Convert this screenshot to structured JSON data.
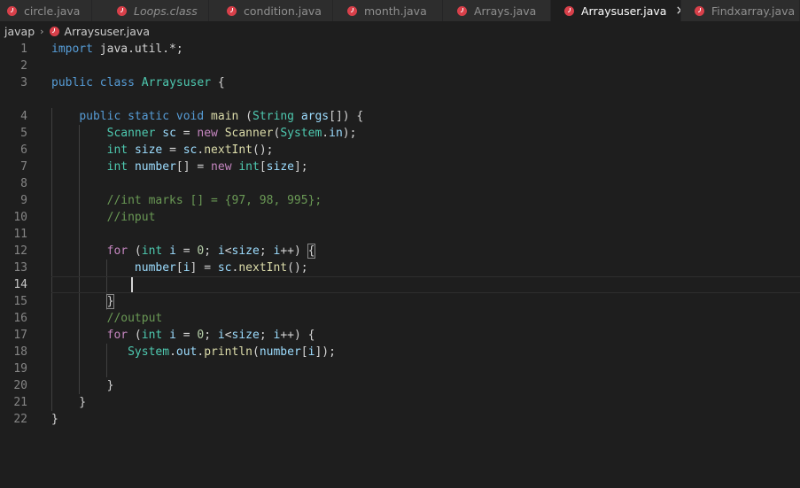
{
  "tabs": [
    {
      "label": "circle.java",
      "italic": false,
      "active": false
    },
    {
      "label": "Loops.class",
      "italic": true,
      "active": false
    },
    {
      "label": "condition.java",
      "italic": false,
      "active": false
    },
    {
      "label": "month.java",
      "italic": false,
      "active": false
    },
    {
      "label": "Arrays.java",
      "italic": false,
      "active": false
    },
    {
      "label": "Arraysuser.java",
      "italic": false,
      "active": true
    },
    {
      "label": "Findxarray.java",
      "italic": false,
      "active": false
    }
  ],
  "tab_icon": "java-file-icon",
  "close_icon": "×",
  "breadcrumb": {
    "folder": "javap",
    "separator": "›",
    "file": "Arraysuser.java"
  },
  "editor": {
    "current_line": 14,
    "lines": [
      {
        "n": "1",
        "text": "import java.util.*;"
      },
      {
        "n": "2",
        "text": ""
      },
      {
        "n": "3",
        "text": "public class Arraysuser {"
      },
      {
        "n": "4",
        "text": "    public static void main (String args[]) {"
      },
      {
        "n": "5",
        "text": "        Scanner sc = new Scanner(System.in);"
      },
      {
        "n": "6",
        "text": "        int size = sc.nextInt();"
      },
      {
        "n": "7",
        "text": "        int number[] = new int[size];"
      },
      {
        "n": "8",
        "text": ""
      },
      {
        "n": "9",
        "text": "        //int marks [] = {97, 98, 995};"
      },
      {
        "n": "10",
        "text": "        //input"
      },
      {
        "n": "11",
        "text": ""
      },
      {
        "n": "12",
        "text": "        for (int i = 0; i<size; i++) {"
      },
      {
        "n": "13",
        "text": "            number[i] = sc.nextInt();"
      },
      {
        "n": "14",
        "text": ""
      },
      {
        "n": "15",
        "text": "        }"
      },
      {
        "n": "16",
        "text": "        //output"
      },
      {
        "n": "17",
        "text": "        for (int i = 0; i<size; i++) {"
      },
      {
        "n": "18",
        "text": "           System.out.println(number[i]);"
      },
      {
        "n": "19",
        "text": ""
      },
      {
        "n": "20",
        "text": "        }"
      },
      {
        "n": "21",
        "text": "    }"
      },
      {
        "n": "22",
        "text": "}"
      }
    ]
  }
}
